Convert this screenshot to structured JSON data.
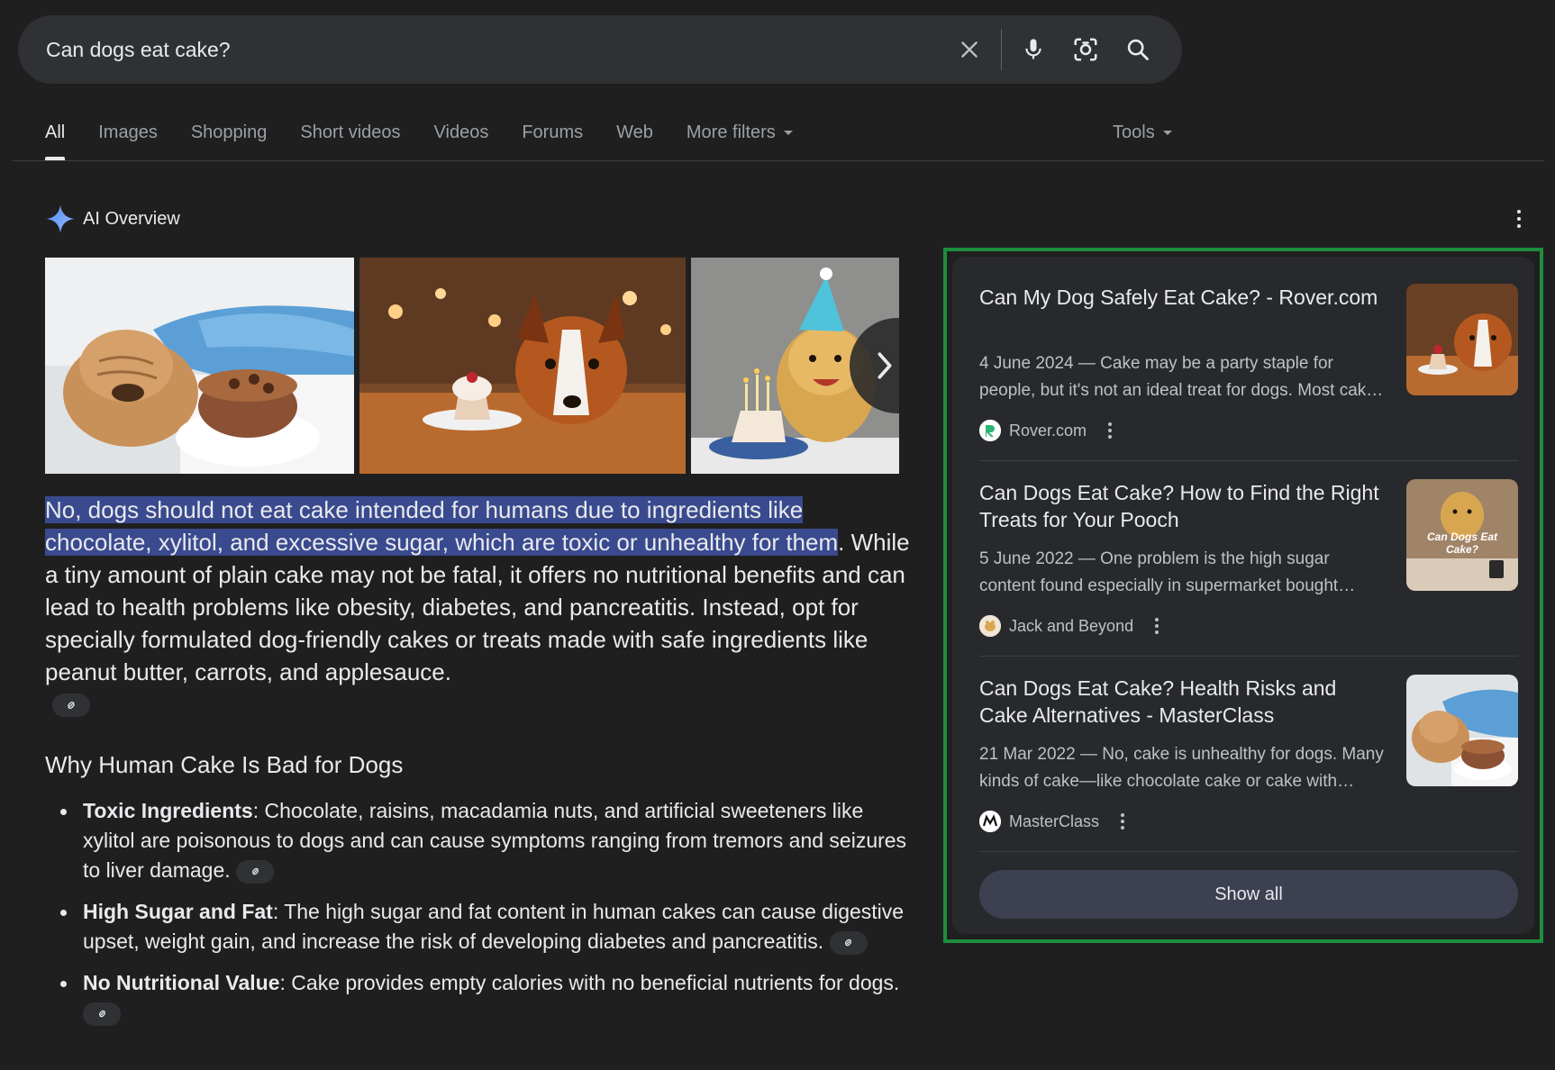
{
  "search": {
    "query": "Can dogs eat cake?",
    "icons": [
      "close-icon",
      "microphone-icon",
      "lens-icon",
      "search-icon"
    ]
  },
  "tabs": [
    {
      "label": "All",
      "active": true
    },
    {
      "label": "Images"
    },
    {
      "label": "Shopping"
    },
    {
      "label": "Short videos"
    },
    {
      "label": "Videos"
    },
    {
      "label": "Forums"
    },
    {
      "label": "Web"
    },
    {
      "label": "More filters",
      "dropdown": true
    }
  ],
  "tools_label": "Tools",
  "ai_overview": {
    "title": "AI Overview",
    "images": [
      "wrinkly dog with chocolate cake",
      "border collie with cupcake",
      "golden retriever with party hat and birthday cake"
    ],
    "answer_highlight": "No, dogs should not eat cake intended for humans due to ingredients like chocolate, xylitol, and excessive sugar, which are toxic or unhealthy for them",
    "answer_rest": ". While a tiny amount of plain cake may not be fatal, it offers no nutritional benefits and can lead to health problems like obesity, diabetes, and pancreatitis. Instead, opt for specially formulated dog-friendly cakes or treats made with safe ingredients like peanut butter, carrots, and applesauce.",
    "section_heading": "Why Human Cake Is Bad for Dogs",
    "bullets": [
      {
        "title": "Toxic Ingredients",
        "text": ": Chocolate, raisins, macadamia nuts, and artificial sweeteners like xylitol are poisonous to dogs and can cause symptoms ranging from tremors and seizures to liver damage."
      },
      {
        "title": "High Sugar and Fat",
        "text": ": The high sugar and fat content in human cakes can cause digestive upset, weight gain, and increase the risk of developing diabetes and pancreatitis."
      },
      {
        "title": "No Nutritional Value",
        "text": ": Cake provides empty calories with no beneficial nutrients for dogs."
      }
    ]
  },
  "sources": {
    "items": [
      {
        "title": "Can My Dog Safely Eat Cake? - Rover.com",
        "snippet": "4 June 2024 — Cake may be a party staple for people, but it's not an ideal treat for dogs. Most cakes contain ingredients that can upset a dog's stomach.",
        "site": "Rover.com",
        "favicon_color": "#2cb472"
      },
      {
        "title": "Can Dogs Eat Cake? How to Find the Right Treats for Your Pooch",
        "snippet": "5 June 2022 — One problem is the high sugar content found especially in supermarket bought cakes and other treats.",
        "site": "Jack and Beyond",
        "thumb_text": "Can Dogs Eat Cake?",
        "favicon_color": "#f0e6d8"
      },
      {
        "title": "Can Dogs Eat Cake? Health Risks and Cake Alternatives - MasterClass",
        "snippet": "21 Mar 2022 — No, cake is unhealthy for dogs. Many kinds of cake—like chocolate cake or cake with raisins—are toxic to dogs.",
        "site": "MasterClass",
        "favicon_color": "#111111"
      }
    ],
    "show_all_label": "Show all",
    "panel_border_color": "#1e8e3e"
  }
}
